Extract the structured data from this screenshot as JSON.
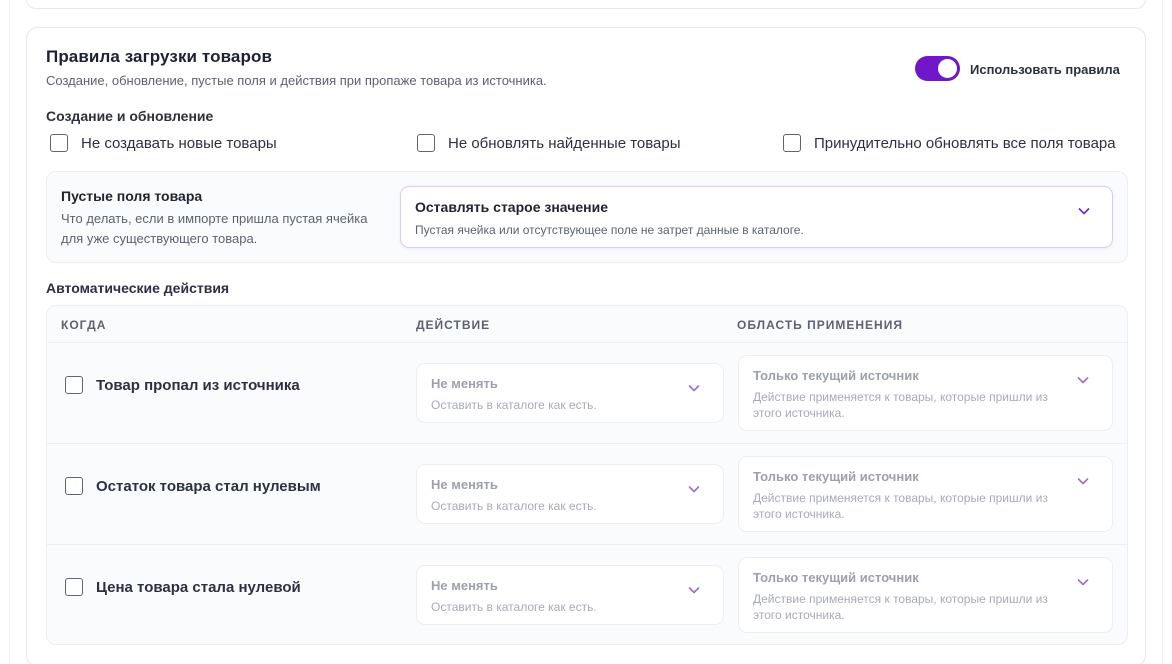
{
  "section": {
    "title": "Правила загрузки товаров",
    "subtitle": "Создание, обновление, пустые поля и действия при пропаже товара из источника.",
    "toggle_label": "Использовать правила",
    "toggle_on": true
  },
  "create_update": {
    "heading": "Создание и обновление",
    "options": [
      {
        "label": "Не создавать новые товары",
        "checked": false
      },
      {
        "label": "Не обновлять найденные товары",
        "checked": false
      },
      {
        "label": "Принудительно обновлять все поля товара",
        "checked": false
      }
    ]
  },
  "empty_fields": {
    "title": "Пустые поля товара",
    "description": "Что делать, если в импорте пришла пустая ячейка для уже существующего товара.",
    "selected_value": "Оставлять старое значение",
    "selected_hint": "Пустая ячейка или отсутствующее поле не затрет данные в каталоге."
  },
  "auto_actions": {
    "heading": "Автоматические действия",
    "columns": [
      "КОГДА",
      "ДЕЙСТВИЕ",
      "ОБЛАСТЬ ПРИМЕНЕНИЯ"
    ],
    "rows": [
      {
        "when": "Товар пропал из источника",
        "checked": false,
        "action": "Не менять",
        "action_hint": "Оставить в каталоге как есть.",
        "scope": "Только текущий источник",
        "scope_hint": "Действие применяется к товары, которые пришли из этого источника."
      },
      {
        "when": "Остаток товара стал нулевым",
        "checked": false,
        "action": "Не менять",
        "action_hint": "Оставить в каталоге как есть.",
        "scope": "Только текущий источник",
        "scope_hint": "Действие применяется к товары, которые пришли из этого источника."
      },
      {
        "when": "Цена товара стала нулевой",
        "checked": false,
        "action": "Не менять",
        "action_hint": "Оставить в каталоге как есть.",
        "scope": "Только текущий источник",
        "scope_hint": "Действие применяется к товары, которые пришли из этого источника."
      }
    ]
  },
  "icons": {
    "chevron": "chevron-down-icon"
  },
  "colors": {
    "accent": "#6f16c9",
    "chevron": "#7a2fc6",
    "chevron_disabled": "#9b6fd0"
  }
}
